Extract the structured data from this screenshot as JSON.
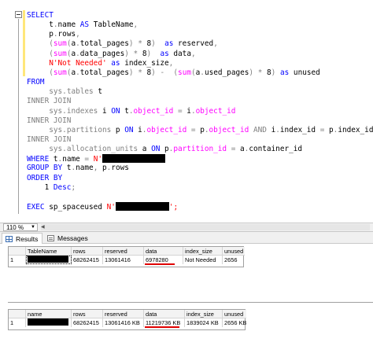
{
  "editor": {
    "lines": [
      [
        {
          "t": "SELECT",
          "c": "kw"
        }
      ],
      [
        {
          "t": "     t",
          "c": ""
        },
        {
          "t": ".",
          "c": "op"
        },
        {
          "t": "name ",
          "c": ""
        },
        {
          "t": "AS",
          "c": "kw"
        },
        {
          "t": " TableName",
          "c": ""
        },
        {
          "t": ",",
          "c": "op"
        }
      ],
      [
        {
          "t": "     p",
          "c": ""
        },
        {
          "t": ".",
          "c": "op"
        },
        {
          "t": "rows",
          "c": ""
        },
        {
          "t": ",",
          "c": "op"
        }
      ],
      [
        {
          "t": "     (",
          "c": "op"
        },
        {
          "t": "sum",
          "c": "fn"
        },
        {
          "t": "(",
          "c": "op"
        },
        {
          "t": "a",
          "c": ""
        },
        {
          "t": ".",
          "c": "op"
        },
        {
          "t": "total_pages",
          "c": ""
        },
        {
          "t": ")",
          "c": "op"
        },
        {
          "t": " ",
          "c": ""
        },
        {
          "t": "*",
          "c": "op"
        },
        {
          "t": " 8",
          "c": ""
        },
        {
          "t": ")",
          "c": "op"
        },
        {
          "t": "  ",
          "c": ""
        },
        {
          "t": "as",
          "c": "kw"
        },
        {
          "t": " reserved",
          "c": ""
        },
        {
          "t": ",",
          "c": "op"
        }
      ],
      [
        {
          "t": "     (",
          "c": "op"
        },
        {
          "t": "sum",
          "c": "fn"
        },
        {
          "t": "(",
          "c": "op"
        },
        {
          "t": "a",
          "c": ""
        },
        {
          "t": ".",
          "c": "op"
        },
        {
          "t": "data_pages",
          "c": ""
        },
        {
          "t": ")",
          "c": "op"
        },
        {
          "t": " ",
          "c": ""
        },
        {
          "t": "*",
          "c": "op"
        },
        {
          "t": " 8",
          "c": ""
        },
        {
          "t": ")",
          "c": "op"
        },
        {
          "t": "  ",
          "c": ""
        },
        {
          "t": "as",
          "c": "kw"
        },
        {
          "t": " data",
          "c": ""
        },
        {
          "t": ",",
          "c": "op"
        }
      ],
      [
        {
          "t": "     ",
          "c": ""
        },
        {
          "t": "N'Not Needed'",
          "c": "str"
        },
        {
          "t": " ",
          "c": ""
        },
        {
          "t": "as",
          "c": "kw"
        },
        {
          "t": " index_size",
          "c": ""
        },
        {
          "t": ",",
          "c": "op"
        }
      ],
      [
        {
          "t": "     (",
          "c": "op"
        },
        {
          "t": "sum",
          "c": "fn"
        },
        {
          "t": "(",
          "c": "op"
        },
        {
          "t": "a",
          "c": ""
        },
        {
          "t": ".",
          "c": "op"
        },
        {
          "t": "total_pages",
          "c": ""
        },
        {
          "t": ")",
          "c": "op"
        },
        {
          "t": " ",
          "c": ""
        },
        {
          "t": "*",
          "c": "op"
        },
        {
          "t": " 8",
          "c": ""
        },
        {
          "t": ")",
          "c": "op"
        },
        {
          "t": " ",
          "c": ""
        },
        {
          "t": "-",
          "c": "op"
        },
        {
          "t": "  (",
          "c": "op"
        },
        {
          "t": "sum",
          "c": "fn"
        },
        {
          "t": "(",
          "c": "op"
        },
        {
          "t": "a",
          "c": ""
        },
        {
          "t": ".",
          "c": "op"
        },
        {
          "t": "used_pages",
          "c": ""
        },
        {
          "t": ")",
          "c": "op"
        },
        {
          "t": " ",
          "c": ""
        },
        {
          "t": "*",
          "c": "op"
        },
        {
          "t": " 8",
          "c": ""
        },
        {
          "t": ")",
          "c": "op"
        },
        {
          "t": " ",
          "c": ""
        },
        {
          "t": "as",
          "c": "kw"
        },
        {
          "t": " unused",
          "c": ""
        }
      ],
      [
        {
          "t": "FROM",
          "c": "kw"
        }
      ],
      [
        {
          "t": "     sys",
          "c": "op"
        },
        {
          "t": ".",
          "c": "op"
        },
        {
          "t": "tables",
          "c": "op"
        },
        {
          "t": " t",
          "c": ""
        }
      ],
      [
        {
          "t": "INNER JOIN",
          "c": "op"
        }
      ],
      [
        {
          "t": "     sys",
          "c": "op"
        },
        {
          "t": ".",
          "c": "op"
        },
        {
          "t": "indexes",
          "c": "op"
        },
        {
          "t": " i ",
          "c": ""
        },
        {
          "t": "ON",
          "c": "kw"
        },
        {
          "t": " t",
          "c": ""
        },
        {
          "t": ".",
          "c": "op"
        },
        {
          "t": "object_id",
          "c": "fn"
        },
        {
          "t": " ",
          "c": ""
        },
        {
          "t": "=",
          "c": "op"
        },
        {
          "t": " i",
          "c": ""
        },
        {
          "t": ".",
          "c": "op"
        },
        {
          "t": "object_id",
          "c": "fn"
        }
      ],
      [
        {
          "t": "INNER JOIN",
          "c": "op"
        }
      ],
      [
        {
          "t": "     sys",
          "c": "op"
        },
        {
          "t": ".",
          "c": "op"
        },
        {
          "t": "partitions",
          "c": "op"
        },
        {
          "t": " p ",
          "c": ""
        },
        {
          "t": "ON",
          "c": "kw"
        },
        {
          "t": " i",
          "c": ""
        },
        {
          "t": ".",
          "c": "op"
        },
        {
          "t": "object_id",
          "c": "fn"
        },
        {
          "t": " ",
          "c": ""
        },
        {
          "t": "=",
          "c": "op"
        },
        {
          "t": " p",
          "c": ""
        },
        {
          "t": ".",
          "c": "op"
        },
        {
          "t": "object_id",
          "c": "fn"
        },
        {
          "t": " ",
          "c": ""
        },
        {
          "t": "AND",
          "c": "op"
        },
        {
          "t": " i",
          "c": ""
        },
        {
          "t": ".",
          "c": "op"
        },
        {
          "t": "index_id",
          "c": ""
        },
        {
          "t": " ",
          "c": ""
        },
        {
          "t": "=",
          "c": "op"
        },
        {
          "t": " p",
          "c": ""
        },
        {
          "t": ".",
          "c": "op"
        },
        {
          "t": "index_id",
          "c": ""
        }
      ],
      [
        {
          "t": "INNER JOIN",
          "c": "op"
        }
      ],
      [
        {
          "t": "     sys",
          "c": "op"
        },
        {
          "t": ".",
          "c": "op"
        },
        {
          "t": "allocation_units",
          "c": "op"
        },
        {
          "t": " a ",
          "c": ""
        },
        {
          "t": "ON",
          "c": "kw"
        },
        {
          "t": " p",
          "c": ""
        },
        {
          "t": ".",
          "c": "op"
        },
        {
          "t": "partition_id",
          "c": "fn"
        },
        {
          "t": " ",
          "c": ""
        },
        {
          "t": "=",
          "c": "op"
        },
        {
          "t": " a",
          "c": ""
        },
        {
          "t": ".",
          "c": "op"
        },
        {
          "t": "container_id",
          "c": ""
        }
      ],
      [
        {
          "t": "WHERE",
          "c": "kw"
        },
        {
          "t": " t",
          "c": ""
        },
        {
          "t": ".",
          "c": "op"
        },
        {
          "t": "name ",
          "c": ""
        },
        {
          "t": "=",
          "c": "op"
        },
        {
          "t": " ",
          "c": ""
        },
        {
          "t": "N'",
          "c": "str"
        },
        {
          "t": "#R80",
          "c": "redact"
        }
      ],
      [
        {
          "t": "GROUP BY",
          "c": "kw"
        },
        {
          "t": " t",
          "c": ""
        },
        {
          "t": ".",
          "c": "op"
        },
        {
          "t": "name",
          "c": ""
        },
        {
          "t": ",",
          "c": "op"
        },
        {
          "t": " p",
          "c": ""
        },
        {
          "t": ".",
          "c": "op"
        },
        {
          "t": "rows",
          "c": ""
        }
      ],
      [
        {
          "t": "ORDER BY",
          "c": "kw"
        }
      ],
      [
        {
          "t": "    1 ",
          "c": ""
        },
        {
          "t": "Desc",
          "c": "kw"
        },
        {
          "t": ";",
          "c": "op"
        }
      ],
      [
        {
          "t": "",
          "c": ""
        }
      ],
      [
        {
          "t": "EXEC",
          "c": "kw"
        },
        {
          "t": " sp_spaceused ",
          "c": ""
        },
        {
          "t": "N'",
          "c": "str"
        },
        {
          "t": "#R68",
          "c": "redact"
        },
        {
          "t": "';",
          "c": "str"
        }
      ]
    ]
  },
  "zoom": {
    "value": "110 %"
  },
  "tabs": [
    {
      "label": "Results",
      "icon": "grid-icon",
      "active": true
    },
    {
      "label": "Messages",
      "icon": "messages-icon",
      "active": false
    }
  ],
  "grid1": {
    "headers": [
      "TableName",
      "rows",
      "reserved",
      "data",
      "index_size",
      "unused"
    ],
    "rows": [
      {
        "rownum": "1",
        "cells": [
          "",
          "68262415",
          "13061416",
          "6978280",
          "Not Needed",
          "2656"
        ]
      }
    ]
  },
  "grid2": {
    "headers": [
      "name",
      "rows",
      "reserved",
      "data",
      "index_size",
      "unused"
    ],
    "rows": [
      {
        "rownum": "1",
        "cells": [
          "",
          "68262415",
          "13061416 KB",
          "11219736 KB",
          "1839024 KB",
          "2656 KB"
        ]
      }
    ]
  },
  "colors": {
    "keyword": "#0000ff",
    "function": "#ff00ff",
    "string": "#ff0000",
    "operator": "#808080",
    "highlight_underline": "#e00000"
  }
}
